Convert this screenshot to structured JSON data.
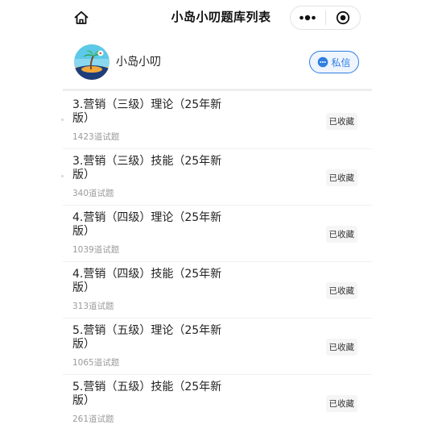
{
  "navbar": {
    "title": "小岛小叨题库列表",
    "home_icon": "home-icon",
    "more_icon": "more-dots-icon",
    "close_icon": "target-close-icon"
  },
  "author": {
    "name": "小岛小叨",
    "dm_label": "私信",
    "dm_icon": "chat-bubble-icon",
    "accent_color": "#2f7de1"
  },
  "banks": [
    {
      "title": "3.营销（三级）理论（25年新版）",
      "count": "1423道试题",
      "badge": "已收藏"
    },
    {
      "title": "3.营销（三级）技能（25年新版）",
      "count": "340道试题",
      "badge": "已收藏"
    },
    {
      "title": "4.营销（四级）理论（25年新版）",
      "count": "1039道试题",
      "badge": "已收藏"
    },
    {
      "title": "4.营销（四级）技能（25年新版）",
      "count": "313道试题",
      "badge": "已收藏"
    },
    {
      "title": "5.营销（五级）理论（25年新版）",
      "count": "1065道试题",
      "badge": "已收藏"
    },
    {
      "title": "5.营销（五级）技能（25年新版）",
      "count": "261道试题",
      "badge": "已收藏"
    }
  ]
}
